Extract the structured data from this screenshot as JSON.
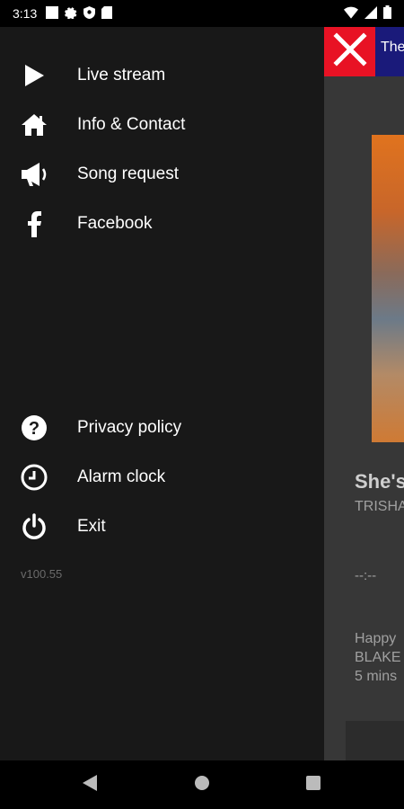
{
  "status_bar": {
    "time": "3:13",
    "left_icons": [
      "square-notification-icon",
      "gear-icon",
      "shield-icon",
      "sd-card-icon"
    ],
    "right_icons": [
      "wifi-icon",
      "signal-icon",
      "battery-icon"
    ]
  },
  "drawer": {
    "items_top": [
      {
        "label": "Live stream",
        "icon": "play-icon"
      },
      {
        "label": "Info & Contact",
        "icon": "home-icon"
      },
      {
        "label": "Song request",
        "icon": "megaphone-icon"
      },
      {
        "label": "Facebook",
        "icon": "facebook-icon"
      }
    ],
    "items_bottom": [
      {
        "label": "Privacy policy",
        "icon": "help-icon"
      },
      {
        "label": "Alarm clock",
        "icon": "clock-icon"
      },
      {
        "label": "Exit",
        "icon": "power-icon"
      }
    ],
    "version": "v100.55"
  },
  "background_app": {
    "ad_banner_text": "The",
    "close_ad_icon": "close-icon",
    "close_ad_color": "#e81224",
    "song_title": "She's",
    "song_artist": "TRISHA",
    "song_time": "--:--",
    "next_line1": "Happy",
    "next_line2": "BLAKE",
    "next_line3": "5 mins"
  },
  "nav_bar": {
    "back_icon": "back-icon",
    "home_icon": "home-circle-icon",
    "recents_icon": "recents-icon"
  },
  "colors": {
    "drawer_bg": "#181818",
    "app_bg": "#373737",
    "text_primary": "#ffffff",
    "text_secondary": "#a0a0a0"
  }
}
